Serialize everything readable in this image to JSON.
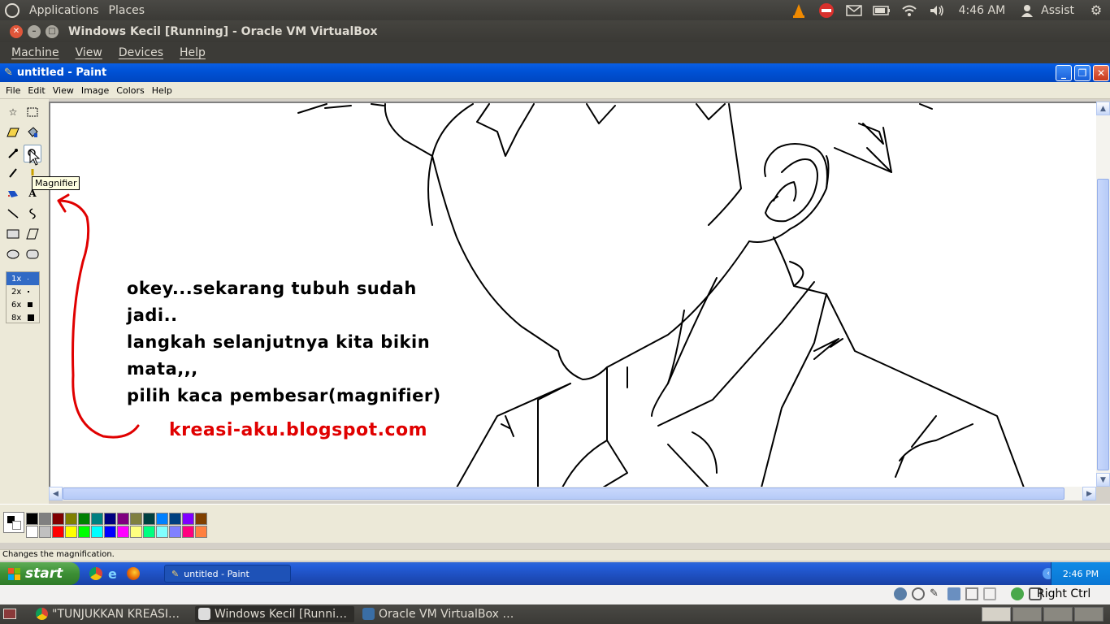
{
  "ubuntu_panel": {
    "menu": [
      "Applications",
      "Places"
    ],
    "time": "4:46 AM",
    "user": "Assist"
  },
  "vbox": {
    "title": "Windows Kecil [Running] - Oracle VM VirtualBox",
    "menu": [
      "Machine",
      "View",
      "Devices",
      "Help"
    ],
    "host_key": "Right Ctrl"
  },
  "paint": {
    "title": "untitled - Paint",
    "menu": [
      "File",
      "Edit",
      "View",
      "Image",
      "Colors",
      "Help"
    ],
    "tooltip": "Magnifier",
    "zoom_options": [
      "1x",
      "2x",
      "6x",
      "8x"
    ],
    "status_text": "Changes the magnification.",
    "palette_top": [
      "#000000",
      "#808080",
      "#800000",
      "#808000",
      "#008000",
      "#008080",
      "#000080",
      "#800080",
      "#808040",
      "#004040",
      "#0080ff",
      "#004080",
      "#8000ff",
      "#804000"
    ],
    "palette_bottom": [
      "#ffffff",
      "#c0c0c0",
      "#ff0000",
      "#ffff00",
      "#00ff00",
      "#00ffff",
      "#0000ff",
      "#ff00ff",
      "#ffff80",
      "#00ff80",
      "#80ffff",
      "#8080ff",
      "#ff0080",
      "#ff8040"
    ]
  },
  "canvas_text": {
    "line1": "okey...sekarang tubuh sudah",
    "line2": "jadi..",
    "line3": "langkah selanjutnya kita bikin",
    "line4": "mata,,,",
    "line5": "pilih kaca pembesar(magnifier)",
    "blog": "kreasi-aku.blogspot.com"
  },
  "xp_taskbar": {
    "start_label": "start",
    "task_label": "untitled - Paint",
    "clock": "2:46 PM"
  },
  "ubuntu_bottom": {
    "tasks": [
      "\"TUNJUKKAN KREASI…",
      "Windows Kecil [Runni…",
      "Oracle VM VirtualBox …"
    ]
  }
}
